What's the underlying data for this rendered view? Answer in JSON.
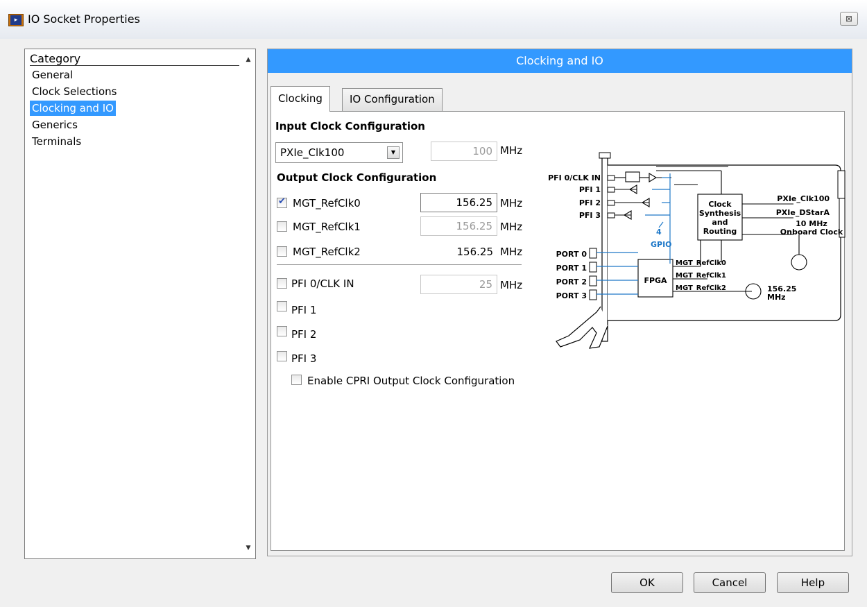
{
  "window": {
    "title": "IO Socket Properties",
    "close_label": "⊠"
  },
  "category": {
    "header": "Category",
    "items": [
      "General",
      "Clock Selections",
      "Clocking and IO",
      "Generics",
      "Terminals"
    ],
    "selected": "Clocking and IO"
  },
  "panel": {
    "title": "Clocking and IO",
    "tabs": [
      "Clocking",
      "IO Configuration"
    ],
    "active_tab": "Clocking"
  },
  "input_clock": {
    "heading": "Input Clock Configuration",
    "source": "PXIe_Clk100",
    "value": "100",
    "unit": "MHz"
  },
  "output_clock": {
    "heading": "Output Clock Configuration",
    "mgt0": {
      "label": "MGT_RefClk0",
      "checked": true,
      "value": "156.25",
      "unit": "MHz"
    },
    "mgt1": {
      "label": "MGT_RefClk1",
      "checked": false,
      "value": "156.25",
      "unit": "MHz"
    },
    "mgt2": {
      "label": "MGT_RefClk2",
      "checked": false,
      "value": "156.25",
      "unit": "MHz"
    },
    "pfi0": {
      "label": "PFI 0/CLK IN",
      "checked": false,
      "value": "25",
      "unit": "MHz"
    },
    "pfi1": {
      "label": "PFI 1",
      "checked": false
    },
    "pfi2": {
      "label": "PFI 2",
      "checked": false
    },
    "pfi3": {
      "label": "PFI 3",
      "checked": false
    },
    "cpri": {
      "label": "Enable CPRI Output Clock Configuration",
      "checked": false
    }
  },
  "diagram": {
    "pfi0": "PFI 0/CLK IN",
    "pfi1": "PFI 1",
    "pfi2": "PFI 2",
    "pfi3": "PFI 3",
    "port0": "PORT 0",
    "port1": "PORT 1",
    "port2": "PORT 2",
    "port3": "PORT 3",
    "clock_1": "Clock",
    "clock_2": "Synthesis",
    "clock_3": "and",
    "clock_4": "Routing",
    "pxie_clk100": "PXIe_Clk100",
    "pxie_dstara": "PXIe_DStarA",
    "onboard_1": "10 MHz",
    "onboard_2": "Onboard Clock",
    "gpio_count": "4",
    "gpio": "GPIO",
    "fpga": "FPGA",
    "mgt0": "MGT_RefClk0",
    "mgt1": "MGT_RefClk1",
    "mgt2": "MGT_RefClk2",
    "osc_1": "156.25",
    "osc_2": "MHz"
  },
  "buttons": {
    "ok": "OK",
    "cancel": "Cancel",
    "help": "Help"
  },
  "colors": {
    "accent": "#3399ff",
    "gpio_blue": "#1e78c8"
  }
}
